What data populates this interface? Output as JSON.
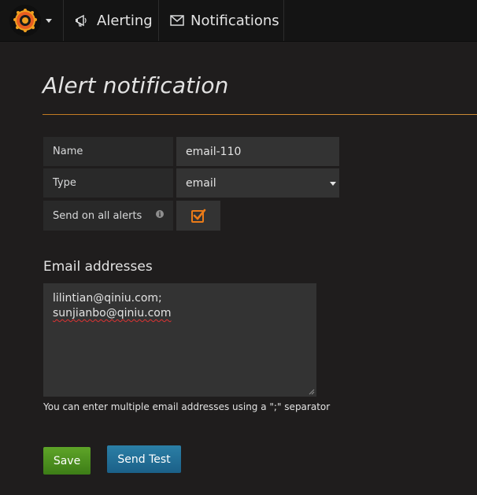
{
  "nav": {
    "alerting_label": "Alerting",
    "notifications_label": "Notifications"
  },
  "page": {
    "title": "Alert notification"
  },
  "form": {
    "name_label": "Name",
    "name_value": "email-110",
    "type_label": "Type",
    "type_value": "email",
    "send_all_label": "Send on all alerts",
    "send_all_checked": true,
    "email_heading": "Email addresses",
    "emails": [
      "lilintian@qiniu.com;",
      "sunjianbo@qiniu.com"
    ],
    "help_text": "You can enter multiple email addresses using a \";\" separator"
  },
  "buttons": {
    "save_label": "Save",
    "test_label": "Send Test"
  },
  "colors": {
    "background": "#1f1d1d",
    "accent_orange": "#eb7b18",
    "save_green": "#4e9123",
    "test_blue": "#246f98"
  }
}
